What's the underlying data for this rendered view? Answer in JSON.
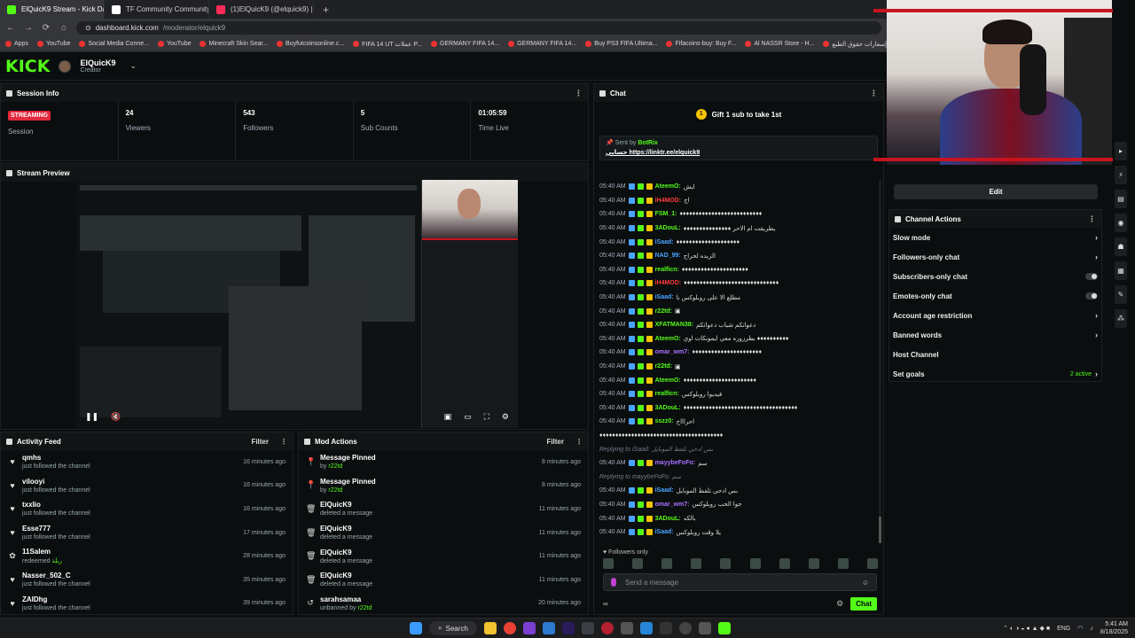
{
  "browser": {
    "tabs": [
      {
        "title": "ElQuicK9 Stream - Kick Dashbo",
        "active": true,
        "color": "#53fc18"
      },
      {
        "title": "TF Community Community / X",
        "active": false,
        "color": "#ffffff"
      },
      {
        "title": "(1)ElQuicK9 (@elquick9) | TikTo",
        "active": false,
        "color": "#ff2a55"
      }
    ],
    "new_tab": "+",
    "url_host": "dashboard.kick.com",
    "url_path": "/moderator/elquick9",
    "bookmarks": [
      "Apps",
      "YouTube",
      "Social Media Conne...",
      "YouTube",
      "Minecraft Skin Sear...",
      "Buyfutcoinsonline.c...",
      "FIFA 14 UT عملات P...",
      "GERMANY FIFA 14...",
      "GERMANY FIFA 14...",
      "Buy PS3 FIFA Ultima...",
      "Fifacoins-buy: Buy F...",
      "Al NASSR Store - H...",
      "إسعارات حقوق الطبع..."
    ]
  },
  "header": {
    "logo": "KICK",
    "channel": "ElQuicK9",
    "role": "Creator"
  },
  "session": {
    "title": "Session Info",
    "live_badge": "STREAMING",
    "session_label": "Session",
    "stats": [
      {
        "value": "24",
        "label": "Viewers"
      },
      {
        "value": "543",
        "label": "Followers"
      },
      {
        "value": "5",
        "label": "Sub Counts"
      },
      {
        "value": "01:05:59",
        "label": "Time Live"
      }
    ]
  },
  "preview": {
    "title": "Stream Preview"
  },
  "activity": {
    "title": "Activity Feed",
    "filter": "Filter",
    "items": [
      {
        "name": "qmhs",
        "desc": "just followed the channel",
        "extra": "",
        "time": "16 minutes ago",
        "icon": "heart"
      },
      {
        "name": "vilooyi",
        "desc": "just followed the channel",
        "extra": "",
        "time": "16 minutes ago",
        "icon": "heart"
      },
      {
        "name": "txxlio",
        "desc": "just followed the channel",
        "extra": "",
        "time": "16 minutes ago",
        "icon": "heart"
      },
      {
        "name": "Esse777",
        "desc": "just followed the channel",
        "extra": "",
        "time": "17 minutes ago",
        "icon": "heart"
      },
      {
        "name": "11Salem",
        "desc": "redeemed",
        "extra": "ربلة",
        "time": "28 minutes ago",
        "icon": "redeem"
      },
      {
        "name": "Nasser_502_C",
        "desc": "just followed the channel",
        "extra": "",
        "time": "35 minutes ago",
        "icon": "heart"
      },
      {
        "name": "ZAIDhg",
        "desc": "just followed the channel",
        "extra": "",
        "time": "39 minutes ago",
        "icon": "heart"
      }
    ]
  },
  "mod": {
    "title": "Mod Actions",
    "filter": "Filter",
    "items": [
      {
        "name": "Message Pinned",
        "desc": "by",
        "extra": "r22td",
        "time": "8 minutes ago",
        "icon": "pin"
      },
      {
        "name": "Message Pinned",
        "desc": "by",
        "extra": "r22td",
        "time": "8 minutes ago",
        "icon": "pin"
      },
      {
        "name": "ElQuicK9",
        "desc": "deleted a message",
        "extra": "",
        "time": "11 minutes ago",
        "icon": "trash"
      },
      {
        "name": "ElQuicK9",
        "desc": "deleted a message",
        "extra": "",
        "time": "11 minutes ago",
        "icon": "trash"
      },
      {
        "name": "ElQuicK9",
        "desc": "deleted a message",
        "extra": "",
        "time": "11 minutes ago",
        "icon": "trash"
      },
      {
        "name": "ElQuicK9",
        "desc": "deleted a message",
        "extra": "",
        "time": "11 minutes ago",
        "icon": "trash"
      },
      {
        "name": "sarahsamaa",
        "desc": "unbanned by",
        "extra": "r22td",
        "time": "20 minutes ago",
        "icon": "unban"
      }
    ]
  },
  "chat": {
    "title": "Chat",
    "gift": "Gift 1 sub to take 1st",
    "pinned_sent_by": "Sent by",
    "pinned_user": "BotRix",
    "pinned_prefix": "حسابي",
    "pinned_link": "https://linktr.ee/elquick9",
    "messages": [
      {
        "ts": "05:40 AM",
        "user": "AteemO:",
        "color": "#53fc18",
        "text": "ايش",
        "reply": false
      },
      {
        "ts": "05:40 AM",
        "user": "iH4MOD:",
        "color": "#ff3b3b",
        "text": "اج",
        "reply": false
      },
      {
        "ts": "05:40 AM",
        "user": "FSM_1:",
        "color": "#53fc18",
        "text": "♦♦♦♦♦♦♦♦♦♦♦♦♦♦♦♦♦♦♦♦♦♦♦♦♦♦",
        "reply": false
      },
      {
        "ts": "05:40 AM",
        "user": "3ADouL:",
        "color": "#53fc18",
        "text": "♦♦♦♦♦♦♦♦♦♦♦♦♦♦♦ يطريقت ام الاحر",
        "reply": false
      },
      {
        "ts": "05:40 AM",
        "user": "iSaad:",
        "color": "#4aa3ff",
        "text": "♦♦♦♦♦♦♦♦♦♦♦♦♦♦♦♦♦♦♦♦",
        "reply": false
      },
      {
        "ts": "05:40 AM",
        "user": "NAD_99:",
        "color": "#4aa3ff",
        "text": "الزيده لحراج",
        "reply": false
      },
      {
        "ts": "05:40 AM",
        "user": "realficn:",
        "color": "#53fc18",
        "text": "♦♦♦♦♦♦♦♦♦♦♦♦♦♦♦♦♦♦♦♦♦",
        "reply": false
      },
      {
        "ts": "05:40 AM",
        "user": "iH4MOD:",
        "color": "#ff3b3b",
        "text": "♦♦♦♦♦♦♦♦♦♦♦♦♦♦♦♦♦♦♦♦♦♦♦♦♦♦♦♦♦♦",
        "reply": false
      },
      {
        "ts": "05:40 AM",
        "user": "iSaad:",
        "color": "#4aa3ff",
        "text": "مطلع الا على روبلوكس نا",
        "reply": false
      },
      {
        "ts": "05:40 AM",
        "user": "r22td:",
        "color": "#53fc18",
        "text": "▣",
        "reply": false
      },
      {
        "ts": "05:40 AM",
        "user": "XFATMAN38:",
        "color": "#53fc18",
        "text": "دعواتكم شباب دعواتكم",
        "reply": false
      },
      {
        "ts": "05:40 AM",
        "user": "AteemO:",
        "color": "#53fc18",
        "text": "بطرزوره معي ايمونكات اوي ♦♦♦♦♦♦♦♦♦♦",
        "reply": false
      },
      {
        "ts": "05:40 AM",
        "user": "omar_wm7:",
        "color": "#a970ff",
        "text": "♦♦♦♦♦♦♦♦♦♦♦♦♦♦♦♦♦♦♦♦♦♦",
        "reply": false
      },
      {
        "ts": "05:40 AM",
        "user": "r22td:",
        "color": "#53fc18",
        "text": "▣",
        "reply": false
      },
      {
        "ts": "05:40 AM",
        "user": "AteemO:",
        "color": "#53fc18",
        "text": "♦♦♦♦♦♦♦♦♦♦♦♦♦♦♦♦♦♦♦♦♦♦♦",
        "reply": false
      },
      {
        "ts": "05:40 AM",
        "user": "realficn:",
        "color": "#53fc18",
        "text": "فيديوا روبلوكس",
        "reply": false
      },
      {
        "ts": "05:40 AM",
        "user": "3ADouL:",
        "color": "#53fc18",
        "text": "♦♦♦♦♦♦♦♦♦♦♦♦♦♦♦♦♦♦♦♦♦♦♦♦♦♦♦♦♦♦♦♦♦♦♦♦",
        "reply": false
      },
      {
        "ts": "05:40 AM",
        "user": "sszz0:",
        "color": "#53fc18",
        "text": "احراااج",
        "reply": false
      },
      {
        "ts": "",
        "user": "",
        "color": "#888888",
        "text": "♦♦♦♦♦♦♦♦♦♦♦♦♦♦♦♦♦♦♦♦♦♦♦♦♦♦♦♦♦♦♦♦♦♦♦♦♦♦♦",
        "reply": false
      },
      {
        "ts": "",
        "user": "",
        "color": "#888888",
        "text": "Replying to iSaad: بس ادحي تلفظ الموبايل",
        "reply": true
      },
      {
        "ts": "05:40 AM",
        "user": "mayybeFoFo:",
        "color": "#a970ff",
        "text": "سم",
        "reply": false
      },
      {
        "ts": "",
        "user": "",
        "color": "#888888",
        "text": "Replying to mayybeFoFo: سم",
        "reply": true
      },
      {
        "ts": "05:40 AM",
        "user": "iSaad:",
        "color": "#4aa3ff",
        "text": "بس ادحي تلفظ الموبايل",
        "reply": false
      },
      {
        "ts": "05:40 AM",
        "user": "omar_wm7:",
        "color": "#a970ff",
        "text": "جوا الحب روبلوكس",
        "reply": false
      },
      {
        "ts": "05:40 AM",
        "user": "3ADouL:",
        "color": "#53fc18",
        "text": "بالكه",
        "reply": false
      },
      {
        "ts": "05:40 AM",
        "user": "iSaad:",
        "color": "#4aa3ff",
        "text": "يلا وقت روبلوكس",
        "reply": false
      }
    ],
    "followers_only": "Followers only",
    "input_placeholder": "Send a message",
    "chat_button": "Chat"
  },
  "channel_actions": {
    "edit": "Edit",
    "title": "Channel Actions",
    "items": [
      {
        "label": "Slow mode",
        "kind": "arrow",
        "extra": ""
      },
      {
        "label": "Followers-only chat",
        "kind": "arrow",
        "extra": ""
      },
      {
        "label": "Subscribers-only chat",
        "kind": "toggle",
        "extra": ""
      },
      {
        "label": "Emotes-only chat",
        "kind": "toggle",
        "extra": ""
      },
      {
        "label": "Account age restriction",
        "kind": "arrow",
        "extra": ""
      },
      {
        "label": "Banned words",
        "kind": "arrow",
        "extra": ""
      },
      {
        "label": "Host Channel",
        "kind": "none",
        "extra": ""
      },
      {
        "label": "Set goals",
        "kind": "arrow",
        "extra": "2 active"
      }
    ]
  },
  "taskbar": {
    "search": "Search",
    "lang": "ENG",
    "time": "5:41 AM",
    "date": "8/18/2025"
  },
  "colors": {
    "accent": "#53fc18",
    "live": "#e3283c",
    "brand_red": "#c8141e"
  }
}
